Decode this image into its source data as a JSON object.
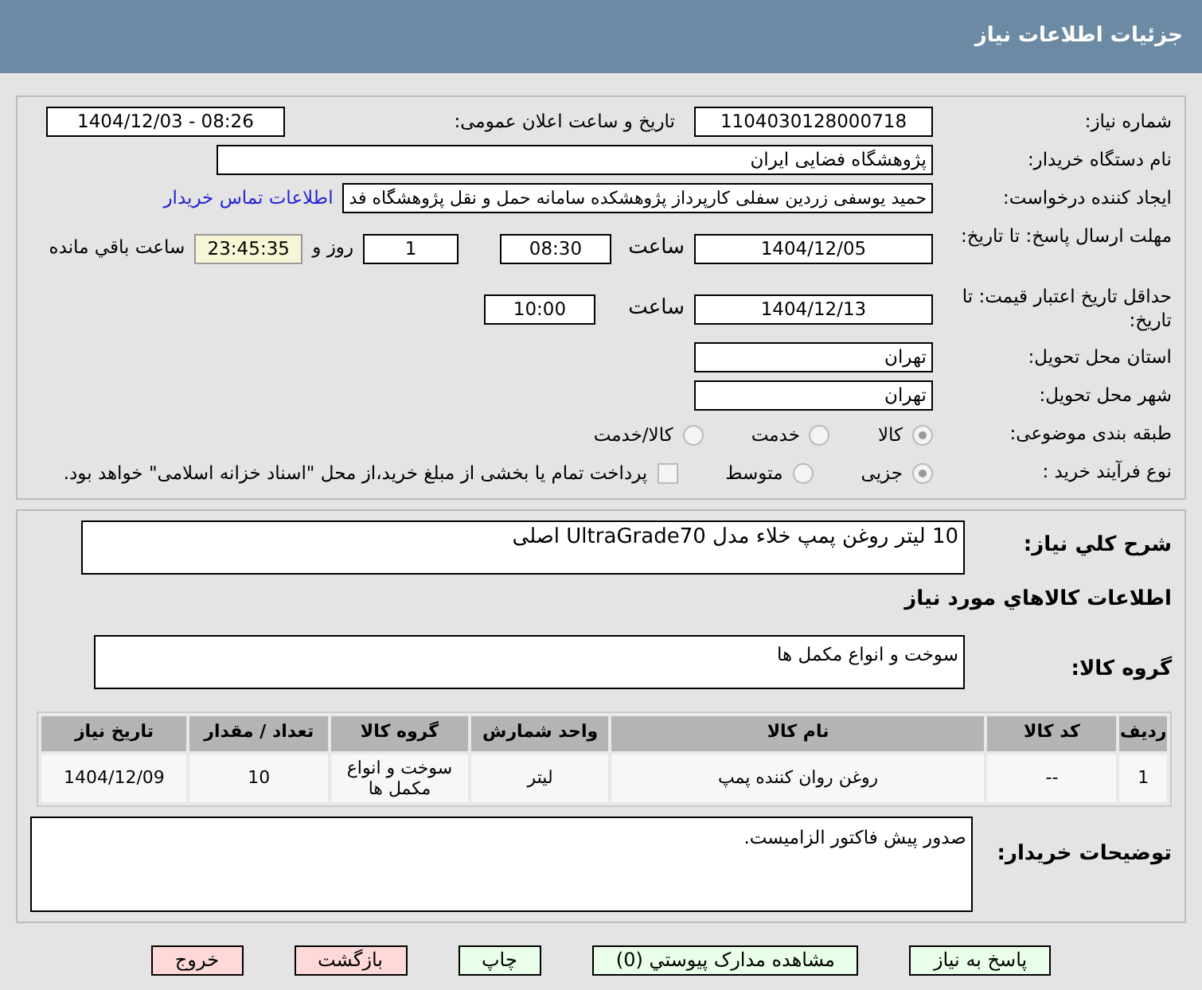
{
  "header": {
    "title": "جزئیات اطلاعات نیاز"
  },
  "need_number": {
    "label": "شماره نیاز:",
    "value": "1104030128000718"
  },
  "announce": {
    "label": "تاریخ و ساعت اعلان عمومی:",
    "value": "1404/12/03 - 08:26"
  },
  "buyer": {
    "label": "نام دستگاه خریدار:",
    "value": "پژوهشگاه فضایی ایران"
  },
  "creator": {
    "label": "ایجاد کننده درخواست:",
    "value": "حمید یوسفی زردین سفلی کارپرداز پژوهشکده سامانه حمل و نقل پژوهشگاه فد",
    "link": "اطلاعات تماس خریدار"
  },
  "deadline": {
    "label": "مهلت ارسال پاسخ: تا تاریخ:",
    "date": "1404/12/05",
    "time_label": "ساعت",
    "time": "08:30",
    "days": "1",
    "days_label": "روز و",
    "remaining": "23:45:35",
    "remaining_label": "ساعت باقي مانده"
  },
  "validity": {
    "label": "حداقل تاریخ اعتبار قیمت: تا تاریخ:",
    "date": "1404/12/13",
    "time_label": "ساعت",
    "time": "10:00"
  },
  "province": {
    "label": "استان محل تحویل:",
    "value": "تهران"
  },
  "city": {
    "label": "شهر محل تحویل:",
    "value": "تهران"
  },
  "category": {
    "label": "طبقه بندی موضوعی:",
    "options": [
      {
        "label": "کالا",
        "selected": true
      },
      {
        "label": "خدمت",
        "selected": false
      },
      {
        "label": "کالا/خدمت",
        "selected": false
      }
    ]
  },
  "process": {
    "label": "نوع فرآیند خرید :",
    "options": [
      {
        "label": "جزیی",
        "selected": true
      },
      {
        "label": "متوسط",
        "selected": false
      }
    ],
    "payment": {
      "checked": false,
      "label": "پرداخت تمام یا بخشی از مبلغ خرید،از محل \"اسناد خزانه اسلامی\" خواهد بود."
    }
  },
  "description": {
    "label": "شرح کلي نياز:",
    "value": "10 لیتر روغن پمپ خلاء مدل UltraGrade70 اصلی"
  },
  "goods_title": "اطلاعات کالاهاي مورد نياز",
  "goods_group": {
    "label": "گروه کالا:",
    "value": "سوخت و انواع مکمل ها"
  },
  "table": {
    "columns": [
      "رديف",
      "کد کالا",
      "نام کالا",
      "واحد شمارش",
      "گروه کالا",
      "تعداد / مقدار",
      "تاریخ نیاز"
    ],
    "rows": [
      [
        "1",
        "--",
        "روغن روان کننده پمپ",
        "لیتر",
        "سوخت و انواع مکمل ها",
        "10",
        "1404/12/09"
      ]
    ]
  },
  "notes": {
    "label": "توضیحات خریدار:",
    "value": "صدور پیش فاکتور الزامیست."
  },
  "buttons": [
    {
      "label": "پاسخ به نياز",
      "kind": "green"
    },
    {
      "label": "مشاهده مدارک پیوستي (0)",
      "kind": "green"
    },
    {
      "label": "چاپ",
      "kind": "green"
    },
    {
      "label": "بازگشت",
      "kind": "red"
    },
    {
      "label": "خروج",
      "kind": "red"
    }
  ]
}
